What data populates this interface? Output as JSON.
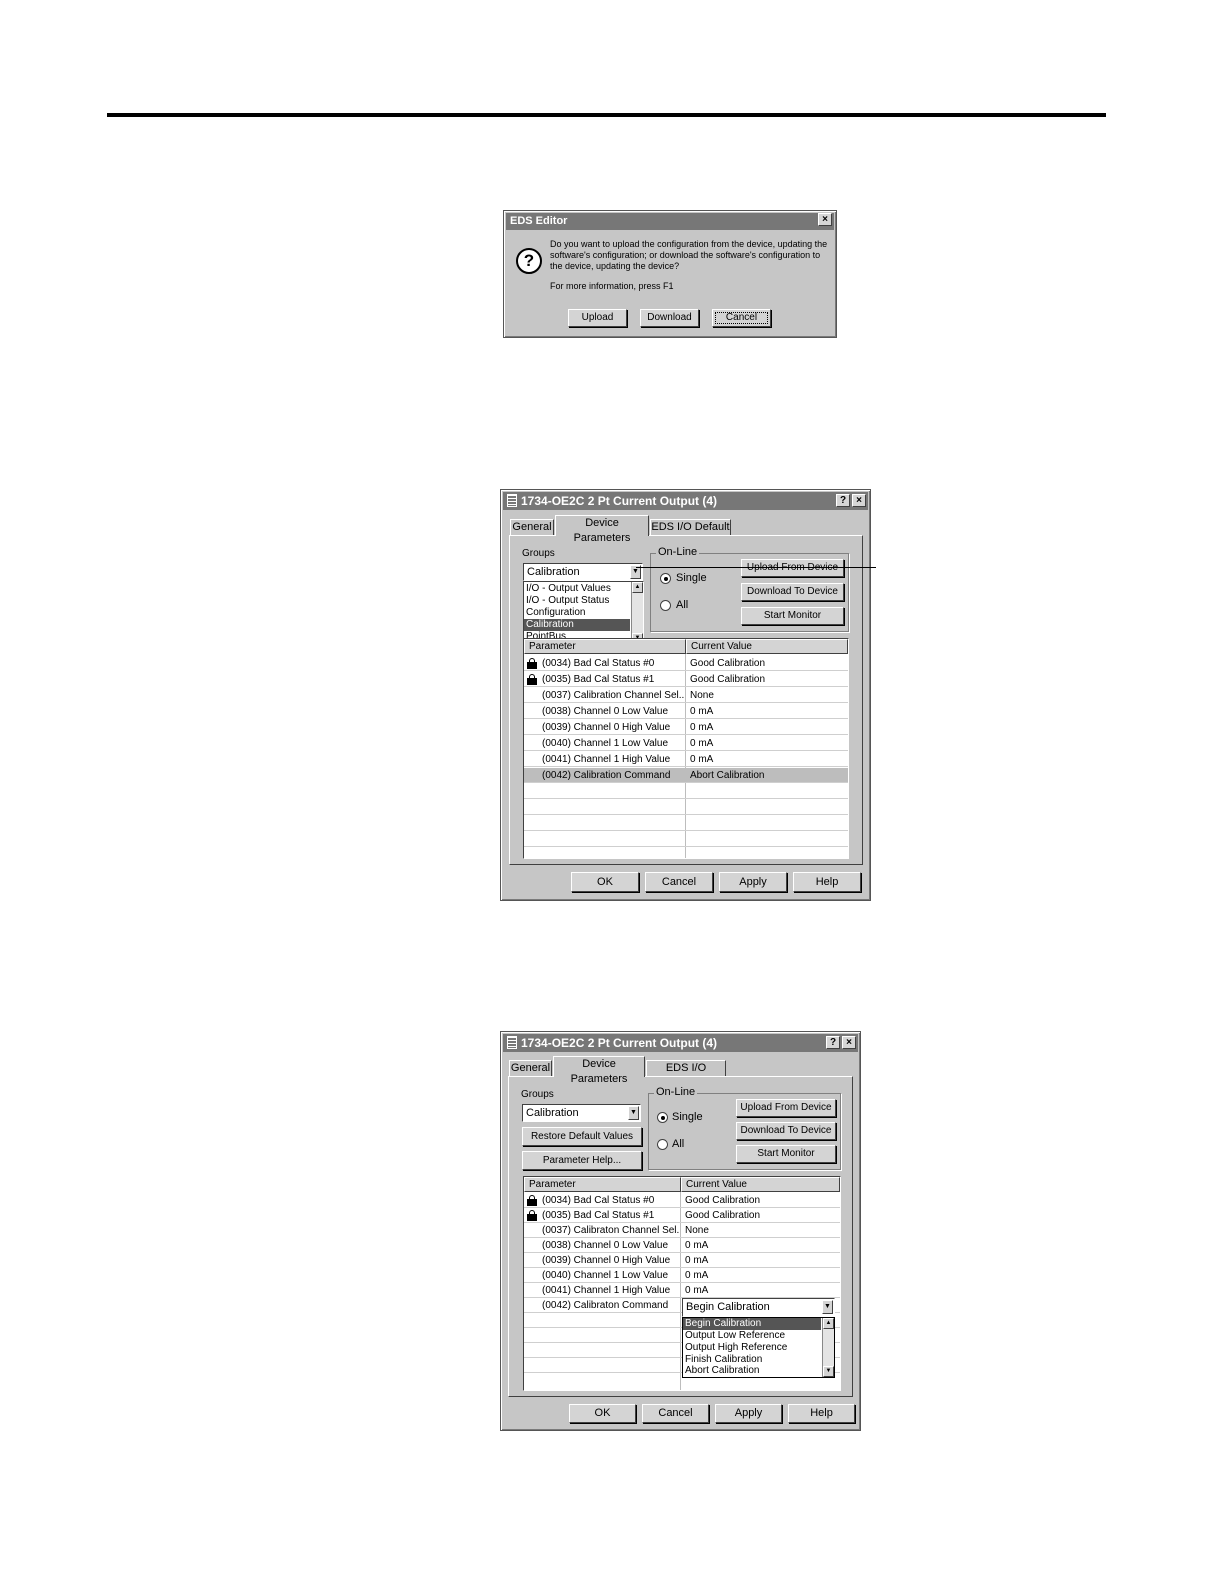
{
  "eds_dialog": {
    "title": "EDS Editor",
    "close_glyph": "×",
    "message_lines": [
      "Do you want to upload the configuration from the device, updating the",
      "software's configuration; or download the software's configuration to",
      "the device, updating the device?"
    ],
    "help_hint": "For more information, press F1",
    "buttons": {
      "upload": "Upload",
      "download": "Download",
      "cancel": "Cancel"
    },
    "icon": "question-icon"
  },
  "window1": {
    "title": "1734-OE2C 2 Pt Current Output (4)",
    "help_glyph": "?",
    "close_glyph": "×",
    "tabs": [
      "General",
      "Device Parameters",
      "EDS I/O Default"
    ],
    "groups_label": "Groups",
    "groups_selected": "Calibration",
    "groups_options": [
      "I/O - Output Values",
      "I/O - Output Status",
      "Configuration",
      "Calibration",
      "PointBus"
    ],
    "groups_selected_index": 3,
    "online_label": "On-Line",
    "radio_single": "Single",
    "radio_all": "All",
    "btn_upload": "Upload From Device",
    "btn_download": "Download To Device",
    "btn_monitor": "Start Monitor",
    "col_parameter": "Parameter",
    "col_value": "Current Value",
    "rows": [
      {
        "param": "(0034) Bad Cal Status #0",
        "value": "Good Calibration",
        "locked": true
      },
      {
        "param": "(0035) Bad Cal Status #1",
        "value": "Good Calibration",
        "locked": true
      },
      {
        "param": "(0037) Calibration Channel Sel...",
        "value": "None",
        "locked": false
      },
      {
        "param": "(0038) Channel 0 Low Value",
        "value": "0 mA",
        "locked": false
      },
      {
        "param": "(0039) Channel 0 High Value",
        "value": "0 mA",
        "locked": false
      },
      {
        "param": "(0040) Channel 1 Low Value",
        "value": "0 mA",
        "locked": false
      },
      {
        "param": "(0041) Channel 1 High Value",
        "value": "0 mA",
        "locked": false
      },
      {
        "param": "(0042) Calibration Command",
        "value": "Abort Calibration",
        "locked": false,
        "selected": true
      }
    ],
    "buttons": {
      "ok": "OK",
      "cancel": "Cancel",
      "apply": "Apply",
      "help": "Help"
    }
  },
  "window2": {
    "title": "1734-OE2C 2 Pt Current Output (4)",
    "help_glyph": "?",
    "close_glyph": "×",
    "tabs": [
      "General",
      "Device Parameters",
      "EDS I/O Default"
    ],
    "groups_label": "Groups",
    "groups_selected": "Calibration",
    "btn_restore": "Restore Default Values",
    "btn_param_help": "Parameter Help...",
    "online_label": "On-Line",
    "radio_single": "Single",
    "radio_all": "All",
    "btn_upload": "Upload From Device",
    "btn_download": "Download To Device",
    "btn_monitor": "Start Monitor",
    "col_parameter": "Parameter",
    "col_value": "Current Value",
    "rows": [
      {
        "param": "(0034) Bad Cal Status #0",
        "value": "Good Calibration",
        "locked": true
      },
      {
        "param": "(0035) Bad Cal Status #1",
        "value": "Good Calibration",
        "locked": true
      },
      {
        "param": "(0037) Calibraton Channel Sel...",
        "value": "None",
        "locked": false
      },
      {
        "param": "(0038) Channel 0 Low Value",
        "value": "0 mA",
        "locked": false
      },
      {
        "param": "(0039) Channel 0 High Value",
        "value": "0 mA",
        "locked": false
      },
      {
        "param": "(0040) Channel 1 Low Value",
        "value": "0 mA",
        "locked": false
      },
      {
        "param": "(0041) Channel 1 High Value",
        "value": "0 mA",
        "locked": false
      },
      {
        "param": "(0042) Calibraton Command",
        "value": "",
        "locked": false
      }
    ],
    "cmd_selected": "Begin Calibration",
    "cmd_options": [
      "Begin Calibration",
      "Output Low Reference",
      "Output High Reference",
      "Finish Calibration",
      "Abort Calibration"
    ],
    "cmd_selected_index": 0,
    "buttons": {
      "ok": "OK",
      "cancel": "Cancel",
      "apply": "Apply",
      "help": "Help"
    }
  },
  "scroll_glyphs": {
    "up": "▲",
    "down": "▼"
  }
}
